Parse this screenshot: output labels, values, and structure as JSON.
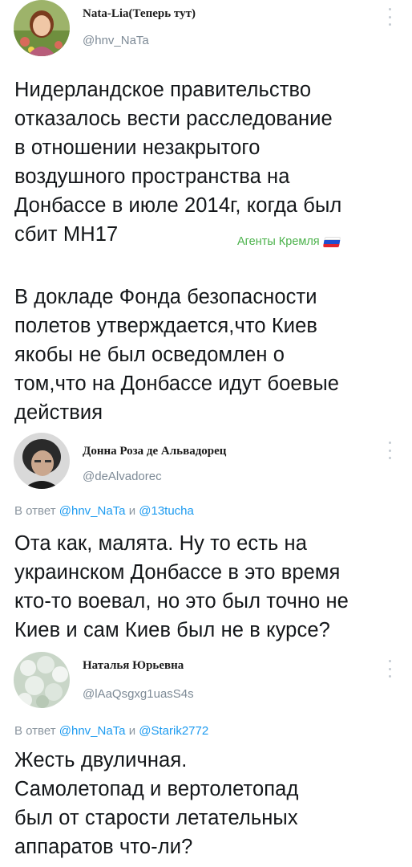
{
  "tweets": [
    {
      "author_name": "Nata-Lia(Теперь тут)",
      "handle": "@hnv_NaTa",
      "lines": [
        "Нидерландское правительство",
        "отказалось вести расследование",
        "в отношении незакрытого",
        "воздушного пространства на",
        "Донбассе в июле 2014г, когда был",
        "сбит МН17"
      ],
      "badge": "Агенты Кремля",
      "lines2": [
        "В докладе Фонда безопасности",
        "полетов утверждается,что Киев",
        "якобы не был осведомлен о",
        "том,что на Донбассе идут боевые",
        "действия"
      ]
    },
    {
      "author_name": "Донна Роза де Альвадорец",
      "handle": "@deAlvadorec",
      "reply_prefix": "В ответ",
      "reply_user1": "@hnv_NaTa",
      "reply_and": "и",
      "reply_user2": "@13tucha",
      "lines": [
        "Ота как, малята. Ну то есть на",
        "украинском Донбассе в это время",
        "кто-то воевал, но это был точно не",
        "Киев и сам Киев был не в курсе?"
      ]
    },
    {
      "author_name": "Наталья Юрьевна",
      "handle": "@lAaQsgxg1uasS4s",
      "reply_prefix": "В ответ",
      "reply_user1": "@hnv_NaTa",
      "reply_and": "и",
      "reply_user2": "@Starik2772",
      "lines": [
        "Жесть двуличная.",
        "Самолетопад и вертолетопад",
        "был от старости летательных",
        "аппаратов что-ли?"
      ]
    }
  ],
  "icons": {
    "more": "more-vertical-icon",
    "flag": "russian-flag-icon"
  },
  "colors": {
    "link": "#1d9bf0",
    "handle": "#7d8a96",
    "badge": "#4bb24b"
  }
}
